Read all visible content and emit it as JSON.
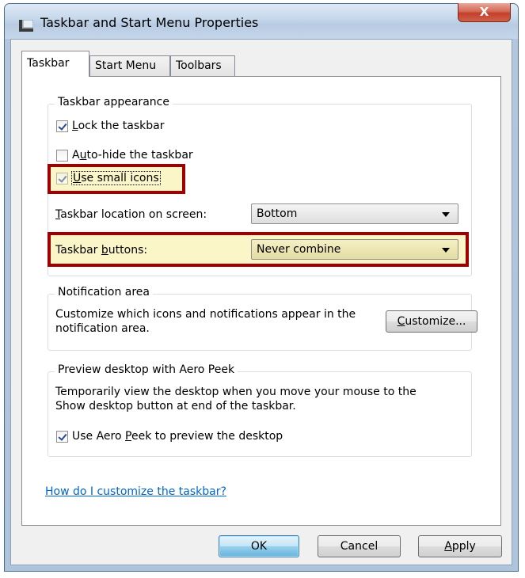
{
  "window": {
    "title": "Taskbar and Start Menu Properties",
    "close_label": "X"
  },
  "tabs": [
    {
      "label": "Taskbar",
      "active": true
    },
    {
      "label": "Start Menu",
      "active": false
    },
    {
      "label": "Toolbars",
      "active": false
    }
  ],
  "appearance": {
    "legend": "Taskbar appearance",
    "lock": {
      "pre": "",
      "accel": "L",
      "post": "ock the taskbar",
      "checked": true
    },
    "autohide": {
      "pre": "A",
      "accel": "u",
      "post": "to-hide the taskbar",
      "checked": false
    },
    "small_icons": {
      "pre": "",
      "accel": "U",
      "post": "se small icons",
      "checked": true
    },
    "location_label": {
      "accel": "T",
      "post": "askbar location on screen:"
    },
    "location_value": "Bottom",
    "buttons_label": {
      "pre": "Taskbar ",
      "accel": "b",
      "post": "uttons:"
    },
    "buttons_value": "Never combine"
  },
  "notification": {
    "legend": "Notification area",
    "text_line1": "Customize which icons and notifications appear in the",
    "text_line2": "notification area.",
    "customize": {
      "accel": "C",
      "post": "ustomize..."
    }
  },
  "peek": {
    "legend": "Preview desktop with Aero Peek",
    "text_line1": "Temporarily view the desktop when you move your mouse to the",
    "text_line2": "Show desktop button at end of the taskbar.",
    "use_peek": {
      "pre": "Use Aero ",
      "accel": "P",
      "post": "eek to preview the desktop",
      "checked": true
    }
  },
  "help_link": "How do I customize the taskbar?",
  "buttons": {
    "ok": "OK",
    "cancel": "Cancel",
    "apply": {
      "accel": "A",
      "post": "pply"
    }
  },
  "colors": {
    "highlight_border": "#a00000",
    "highlight_fill": "#fbf6c8",
    "link": "#0066cc"
  }
}
